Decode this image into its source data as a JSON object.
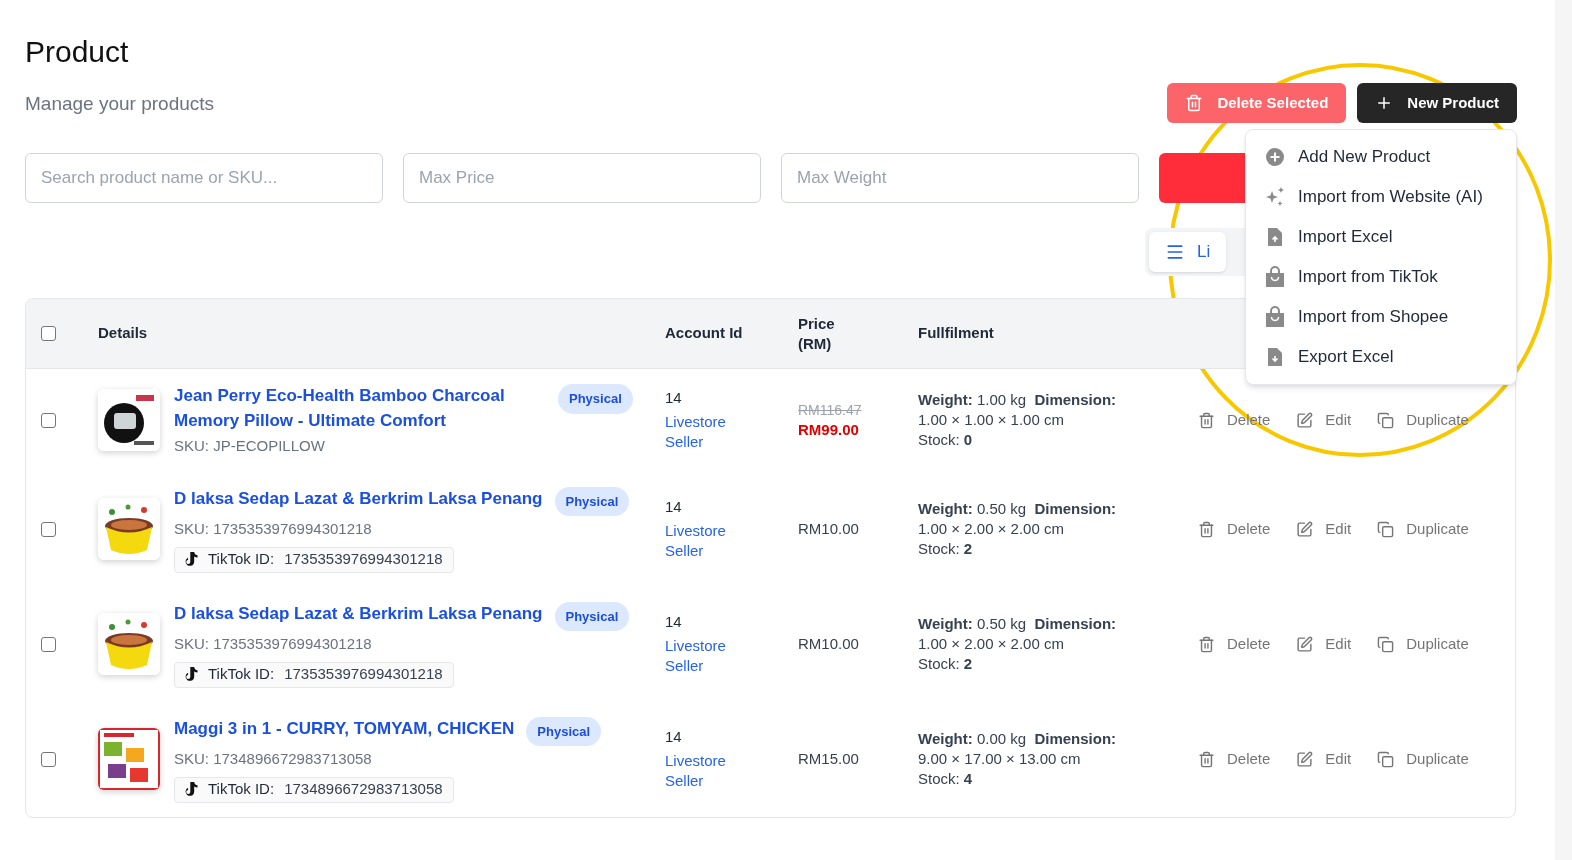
{
  "page": {
    "title": "Product",
    "subtitle": "Manage your products"
  },
  "header_actions": [
    {
      "kind": "delete",
      "label": "Delete Selected"
    },
    {
      "kind": "new",
      "label": "New Product"
    }
  ],
  "filters": [
    {
      "placeholder": "Search product name or SKU..."
    },
    {
      "placeholder": "Max Price"
    },
    {
      "placeholder": "Max Weight"
    }
  ],
  "view_toggle": {
    "label": "Li"
  },
  "menu": [
    {
      "kind": "plus",
      "label": "Add New Product"
    },
    {
      "kind": "sparkle",
      "label": "Import from Website (AI)"
    },
    {
      "kind": "file-up",
      "label": "Import Excel"
    },
    {
      "kind": "bag",
      "label": "Import from TikTok"
    },
    {
      "kind": "bag",
      "label": "Import from Shopee"
    },
    {
      "kind": "file-down",
      "label": "Export Excel"
    }
  ],
  "table": {
    "select_all": {
      "checked": false
    },
    "columns": [
      "Details",
      "Account Id",
      "Price (RM)",
      "Fullfilment"
    ],
    "rows": [
      {
        "checked": false,
        "name": "Jean Perry Eco-Health Bamboo Charcoal Memory Pillow - Ultimate Comfort",
        "type": "Physical",
        "sku": "SKU: JP-ECOPILLOW",
        "account_id": "14",
        "account_name": "Livestore Seller",
        "original_price": "RM116.47",
        "price": "RM99.00",
        "fulfilment": [
          "**Weight:** 1.00 kg  **Dimension:**",
          "1.00 × 1.00 × 1.00 cm",
          "Stock: **0**"
        ],
        "actions": [
          "Delete",
          "Edit",
          "Duplicate"
        ]
      },
      {
        "checked": false,
        "name": "D laksa Sedap Lazat & Berkrim Laksa Penang",
        "type": "Physical",
        "sku": "SKU: 1735353976994301218",
        "tiktok": {
          "label": "TikTok ID:",
          "value": "1735353976994301218"
        },
        "account_id": "14",
        "account_name": "Livestore Seller",
        "price": "RM10.00",
        "fulfilment": [
          "**Weight:** 0.50 kg  **Dimension:**",
          "1.00 × 2.00 × 2.00 cm",
          "Stock: **2**"
        ],
        "actions": [
          "Delete",
          "Edit",
          "Duplicate"
        ]
      },
      {
        "checked": false,
        "name": "D laksa Sedap Lazat & Berkrim Laksa Penang",
        "type": "Physical",
        "sku": "SKU: 1735353976994301218",
        "tiktok": {
          "label": "TikTok ID:",
          "value": "1735353976994301218"
        },
        "account_id": "14",
        "account_name": "Livestore Seller",
        "price": "RM10.00",
        "fulfilment": [
          "**Weight:** 0.50 kg  **Dimension:**",
          "1.00 × 2.00 × 2.00 cm",
          "Stock: **2**"
        ],
        "actions": [
          "Delete",
          "Edit",
          "Duplicate"
        ]
      },
      {
        "checked": false,
        "name": "Maggi 3 in 1 - CURRY, TOMYAM, CHICKEN",
        "type": "Physical",
        "sku": "SKU: 1734896672983713058",
        "tiktok": {
          "label": "TikTok ID:",
          "value": "1734896672983713058"
        },
        "account_id": "14",
        "account_name": "Livestore Seller",
        "price": "RM15.00",
        "fulfilment": [
          "**Weight:** 0.00 kg  **Dimension:**",
          "9.00 × 17.00 × 13.00 cm",
          "Stock: **4**"
        ],
        "actions": [
          "Delete",
          "Edit",
          "Duplicate"
        ]
      }
    ]
  }
}
